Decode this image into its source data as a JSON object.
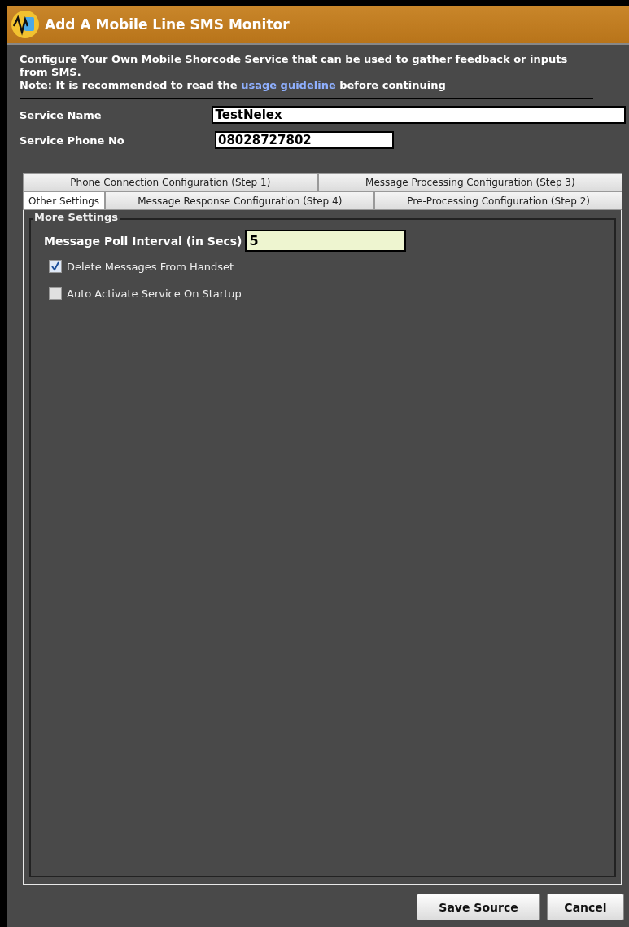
{
  "window": {
    "title": "Add A Mobile Line SMS Monitor"
  },
  "intro": {
    "line_1": "Configure Your Own Mobile Shorcode Service that can be used to gather feedback or inputs from SMS.",
    "note_before": "Note: It is recommended to read the",
    "link": "usage guideline",
    "note_after": "before continuing"
  },
  "fields": [
    {
      "label": "Service Name",
      "value": "TestNelex",
      "kind": "wide"
    },
    {
      "label": "Service Phone No",
      "value": "08028727802",
      "kind": "short"
    }
  ],
  "tab_rows": [
    [
      {
        "label": "Phone Connection Configuration (Step 1)",
        "selected": false
      },
      {
        "label": "Message Processing Configuration (Step 3)",
        "selected": false
      }
    ],
    [
      {
        "label": "Other Settings",
        "selected": true
      },
      {
        "label": "Message Response Configuration (Step 4)",
        "selected": false
      },
      {
        "label": "Pre-Processing Configuration (Step 2)",
        "selected": false
      }
    ]
  ],
  "group": {
    "title": "More Settings",
    "poll_label": "Message Poll Interval (in Secs)",
    "poll_value": "5",
    "options": [
      {
        "label": "Delete Messages From Handset",
        "checked": true
      },
      {
        "label": "Auto Activate Service On Startup",
        "checked": false
      }
    ]
  },
  "buttons": [
    "Save Source",
    "Cancel"
  ]
}
